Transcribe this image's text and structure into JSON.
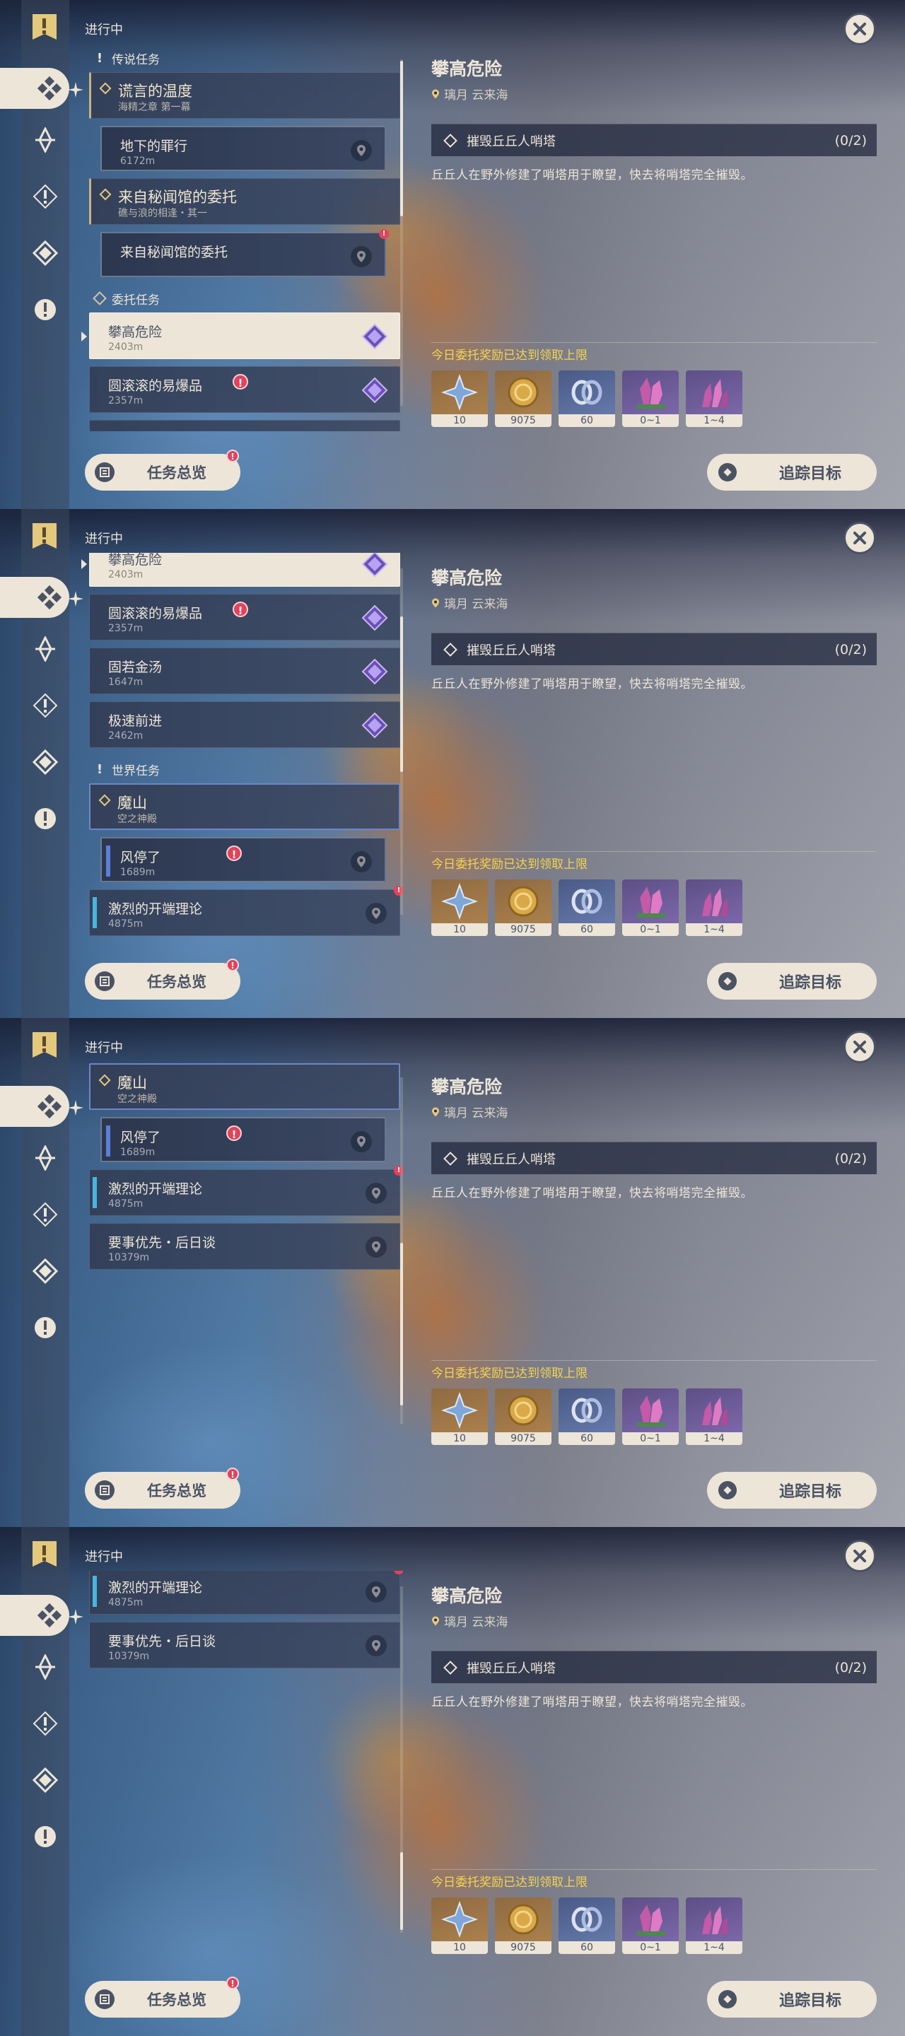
{
  "header": {
    "status_title": "进行中",
    "close_label": "close"
  },
  "sections": {
    "legend": "传说任务",
    "commission": "委托任务",
    "world": "世界任务"
  },
  "quests": {
    "legend_1": {
      "title": "谎言的温度",
      "sub": "海精之章 第一幕"
    },
    "legend_1_step": {
      "title": "地下的罪行",
      "dist": "6172m"
    },
    "legend_2": {
      "title": "来自秘闻馆的委托",
      "sub": "礁与浪的相逢・其一"
    },
    "legend_2_step": {
      "title": "来自秘闻馆的委托"
    },
    "c1": {
      "title": "攀高危险",
      "dist": "2403m"
    },
    "c2": {
      "title": "圆滚滚的易爆品",
      "dist": "2357m"
    },
    "c3": {
      "title": "固若金汤",
      "dist": "1647m"
    },
    "c4": {
      "title": "极速前进",
      "dist": "2462m"
    },
    "w1": {
      "title": "魔山",
      "sub": "空之神殿"
    },
    "w1_step": {
      "title": "风停了",
      "dist": "1689m"
    },
    "w2": {
      "title": "激烈的开端理论",
      "dist": "4875m"
    },
    "w3": {
      "title": "要事优先・后日谈",
      "dist": "10379m"
    }
  },
  "alert_mark": "!",
  "detail": {
    "title": "攀高危险",
    "location": "璃月 云来海",
    "objective": "摧毁丘丘人哨塔",
    "progress": "(0/2)",
    "description": "丘丘人在野外修建了哨塔用于瞭望，快去将哨塔完全摧毁。",
    "reward_title": "今日委托奖励已达到领取上限",
    "rewards": [
      {
        "icon": "adventure-exp-icon",
        "count": "10"
      },
      {
        "icon": "mora-icon",
        "count": "9075"
      },
      {
        "icon": "companionship-exp-icon",
        "count": "60"
      },
      {
        "icon": "crystal-ore-icon",
        "count": "0~1"
      },
      {
        "icon": "crystal-chunks-icon",
        "count": "1~4"
      }
    ]
  },
  "buttons": {
    "overview": "任务总览",
    "track": "追踪目标"
  },
  "colors": {
    "accent": "#ece5d8",
    "dark": "#4a5263",
    "gold_text": "#f6d44d",
    "alert": "#e2435a",
    "world_bar": "#5b7fd6"
  }
}
